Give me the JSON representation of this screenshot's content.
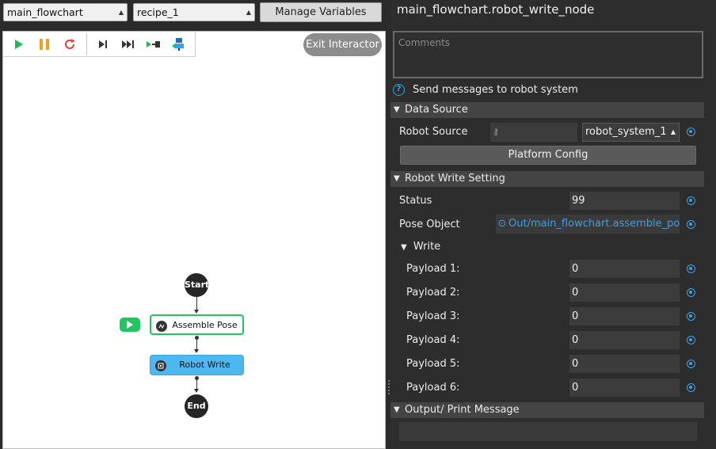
{
  "toolbar_top": {
    "flowchart_select": "main_flowchart",
    "recipe_select": "recipe_1",
    "manage_variables": "Manage Variables"
  },
  "canvas": {
    "exit_interactor": "Exit Interactor",
    "icons": [
      "play-icon",
      "pause-icon",
      "restart-icon",
      "step-icon",
      "step-over-icon",
      "run-to-icon",
      "debug-node-icon"
    ],
    "nodes": {
      "start": "Start",
      "assemble_pose": "Assemble Pose",
      "robot_write": "Robot Write",
      "end": "End"
    }
  },
  "properties": {
    "title": "main_flowchart.robot_write_node",
    "comments_placeholder": "Comments",
    "help_text": "Send messages to robot system",
    "data_source": {
      "section": "Data Source",
      "robot_source_label": "Robot Source",
      "robot_source_value": "robot_system_1",
      "platform_config": "Platform Config"
    },
    "robot_write_setting": {
      "section": "Robot Write Setting",
      "status_label": "Status",
      "status_value": "99",
      "pose_object_label": "Pose Object",
      "pose_object_value": "Out/main_flowchart.assemble_pose_n",
      "write_group": "Write",
      "payloads": [
        {
          "label": "Payload 1:",
          "value": "0"
        },
        {
          "label": "Payload 2:",
          "value": "0"
        },
        {
          "label": "Payload 3:",
          "value": "0"
        },
        {
          "label": "Payload 4:",
          "value": "0"
        },
        {
          "label": "Payload 5:",
          "value": "0"
        },
        {
          "label": "Payload 6:",
          "value": "0"
        }
      ]
    },
    "output": {
      "section": "Output/ Print Message",
      "value": ""
    }
  },
  "colors": {
    "accent": "#3aa0e6",
    "play_green": "#1db954",
    "pause_orange": "#f0a020",
    "restart_red": "#e04040",
    "node_selected_fill": "#4db8f0",
    "node_running_border": "#22c55e"
  }
}
